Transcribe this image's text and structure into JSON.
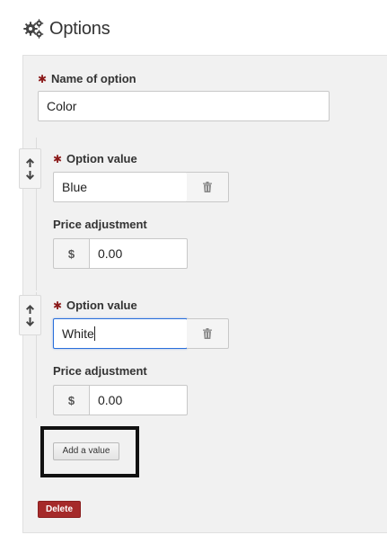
{
  "header": {
    "icon": "gears-icon",
    "title": "Options"
  },
  "option": {
    "name_label": "Name of option",
    "name_value": "Color",
    "values": [
      {
        "value_label": "Option value",
        "value": "Blue",
        "price_label": "Price adjustment",
        "currency": "$",
        "price": "0.00"
      },
      {
        "value_label": "Option value",
        "value": "White",
        "price_label": "Price adjustment",
        "currency": "$",
        "price": "0.00"
      }
    ],
    "add_value_label": "Add a value",
    "delete_label": "Delete"
  },
  "colors": {
    "required": "#8b1a1a",
    "delete": "#a52a2a",
    "focus": "#2a6fdb",
    "panel": "#f1f1f1"
  }
}
